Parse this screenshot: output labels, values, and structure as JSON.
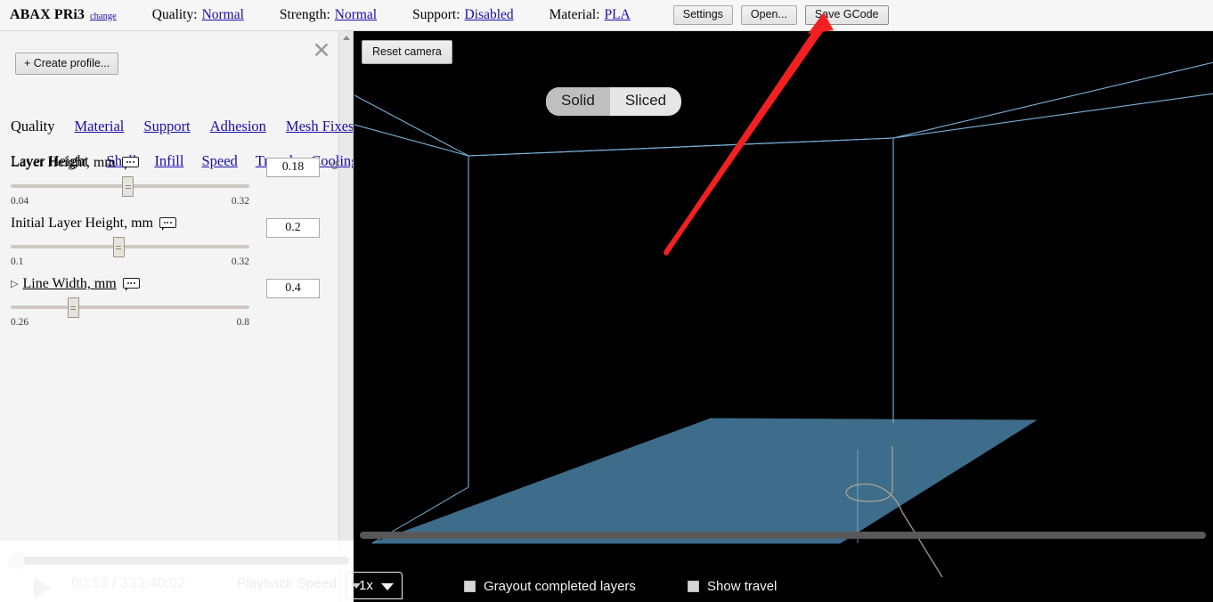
{
  "topbar": {
    "brand": "ABAX PRi3",
    "change_link": "change",
    "groups": [
      {
        "label": "Quality:",
        "value": "Normal"
      },
      {
        "label": "Strength:",
        "value": "Normal"
      },
      {
        "label": "Support:",
        "value": "Disabled"
      },
      {
        "label": "Material:",
        "value": "PLA"
      }
    ],
    "buttons": [
      {
        "label": "Settings"
      },
      {
        "label": "Open..."
      },
      {
        "label": "Save GCode"
      }
    ]
  },
  "panel": {
    "close_icon": "✕",
    "create_profile_label": "+ Create profile...",
    "primary_tabs": [
      {
        "label": "Quality",
        "active": true
      },
      {
        "label": "Material",
        "active": false
      },
      {
        "label": "Support",
        "active": false
      },
      {
        "label": "Adhesion",
        "active": false
      },
      {
        "label": "Mesh Fixes",
        "active": false
      }
    ],
    "secondary_tabs": [
      {
        "label": "Layer Height",
        "active": true
      },
      {
        "label": "Shell",
        "active": false
      },
      {
        "label": "Infill",
        "active": false
      },
      {
        "label": "Speed",
        "active": false
      },
      {
        "label": "Travel",
        "active": false
      },
      {
        "label": "Cooling",
        "active": false
      }
    ],
    "settings": [
      {
        "name": "layer-height",
        "label": "Layer Height, mm",
        "min": "0.04",
        "max": "0.32",
        "value": "0.18",
        "thumb_pct": 49,
        "expandable": false,
        "has_reset": true,
        "reset_icon": "↺"
      },
      {
        "name": "initial-layer-height",
        "label": "Initial Layer Height, mm",
        "min": "0.1",
        "max": "0.32",
        "value": "0.2",
        "thumb_pct": 45,
        "expandable": false,
        "has_reset": false,
        "reset_icon": ""
      },
      {
        "name": "line-width",
        "label": "Line Width, mm",
        "min": "0.26",
        "max": "0.8",
        "value": "0.4",
        "thumb_pct": 26,
        "expandable": true,
        "expander_icon": "▷",
        "has_reset": false,
        "reset_icon": ""
      }
    ]
  },
  "viewport": {
    "reset_camera_label": "Reset camera",
    "view_modes": [
      {
        "label": "Solid",
        "selected": true
      },
      {
        "label": "Sliced",
        "selected": false
      }
    ],
    "colors": {
      "background": "#000000",
      "wireframe": "#7ab4dd",
      "build_plate": "#3d6d8a",
      "annotation_arrow": "#f22020",
      "extrusion_path": "#b5a894"
    }
  },
  "player": {
    "time": "00:13 / 333:40:02",
    "playback_speed_label": "Playback Speed",
    "speed_value": "1x",
    "checkboxes": [
      {
        "label": "Grayout completed layers",
        "checked": false
      },
      {
        "label": "Show travel",
        "checked": false
      }
    ]
  }
}
